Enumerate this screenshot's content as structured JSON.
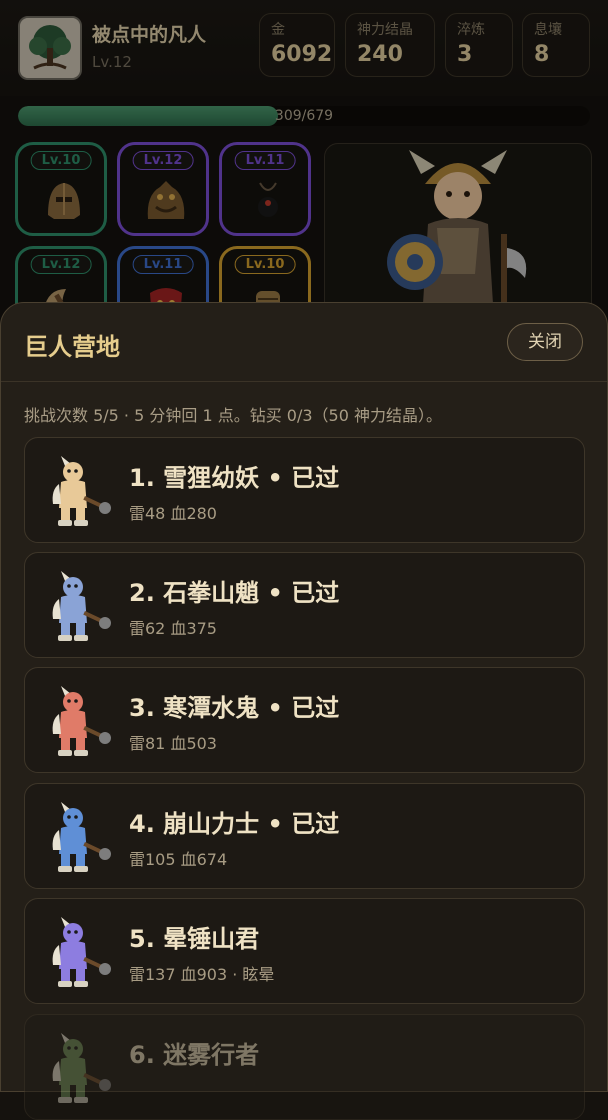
{
  "player": {
    "name": "被点中的凡人",
    "level": "Lv.12",
    "avatar_icon": "tree-icon"
  },
  "stats": [
    {
      "label": "金",
      "value": "6092"
    },
    {
      "label": "神力结晶",
      "value": "240"
    },
    {
      "label": "淬炼",
      "value": "3"
    },
    {
      "label": "息壤",
      "value": "8"
    }
  ],
  "xp": {
    "current": 309,
    "max": 679,
    "text": "309/679"
  },
  "equipment": [
    {
      "level": "Lv.10",
      "color": "#2e8f6b",
      "icon": "helmet-icon"
    },
    {
      "level": "Lv.12",
      "color": "#7c4fd6",
      "icon": "dragon-armor-icon"
    },
    {
      "level": "Lv.11",
      "color": "#7c4fd6",
      "icon": "amulet-icon"
    },
    {
      "level": "Lv.12",
      "color": "#2e8f6b",
      "icon": "axe-icon"
    },
    {
      "level": "Lv.11",
      "color": "#3f6fd0",
      "icon": "demon-mask-icon"
    },
    {
      "level": "Lv.10",
      "color": "#d5a22f",
      "icon": "gauntlet-icon"
    }
  ],
  "modal": {
    "title": "巨人营地",
    "close_label": "关闭",
    "info": "挑战次数 5/5 · 5 分钟回 1 点。钻买 0/3（50 神力结晶）。"
  },
  "enemies": [
    {
      "name": "1. 雪狸幼妖 • 已过",
      "stats": "雷48 血280",
      "color": "#e8c998",
      "locked": false
    },
    {
      "name": "2. 石拳山魈 • 已过",
      "stats": "雷62 血375",
      "color": "#8aa3d6",
      "locked": false
    },
    {
      "name": "3. 寒潭水鬼 • 已过",
      "stats": "雷81 血503",
      "color": "#e07b68",
      "locked": false
    },
    {
      "name": "4. 崩山力士 • 已过",
      "stats": "雷105 血674",
      "color": "#5f8fd6",
      "locked": false
    },
    {
      "name": "5. 晕锤山君",
      "stats": "雷137 血903 · 眩晕",
      "color": "#8d7de0",
      "locked": false
    },
    {
      "name": "6. 迷雾行者",
      "stats": "",
      "color": "#6e8f5a",
      "locked": true
    }
  ]
}
